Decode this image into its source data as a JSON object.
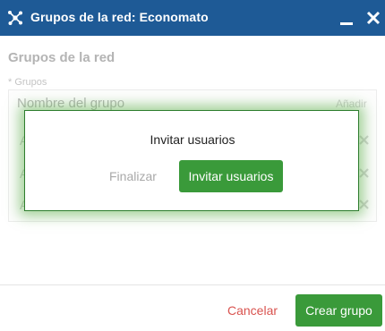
{
  "window": {
    "title": "Grupos de la red: Economato",
    "icon": "network-icon",
    "controls": [
      "minimize-icon",
      "close-icon"
    ],
    "accent": "#1e5a96"
  },
  "form": {
    "section_title": "Grupos de la red",
    "groups_label": "* Grupos",
    "group_name_placeholder": "Nombre del grupo",
    "add_label": "Añadir",
    "rows": [
      {
        "letter": "A"
      },
      {
        "letter": "A"
      },
      {
        "letter": "A"
      }
    ]
  },
  "footer": {
    "cancel_label": "Cancelar",
    "create_label": "Crear grupo",
    "cancel_color": "#d9534f",
    "primary_color": "#3a9a3a"
  },
  "popup": {
    "title": "Invitar usuarios",
    "finish_label": "Finalizar",
    "invite_label": "Invitar usuarios"
  }
}
